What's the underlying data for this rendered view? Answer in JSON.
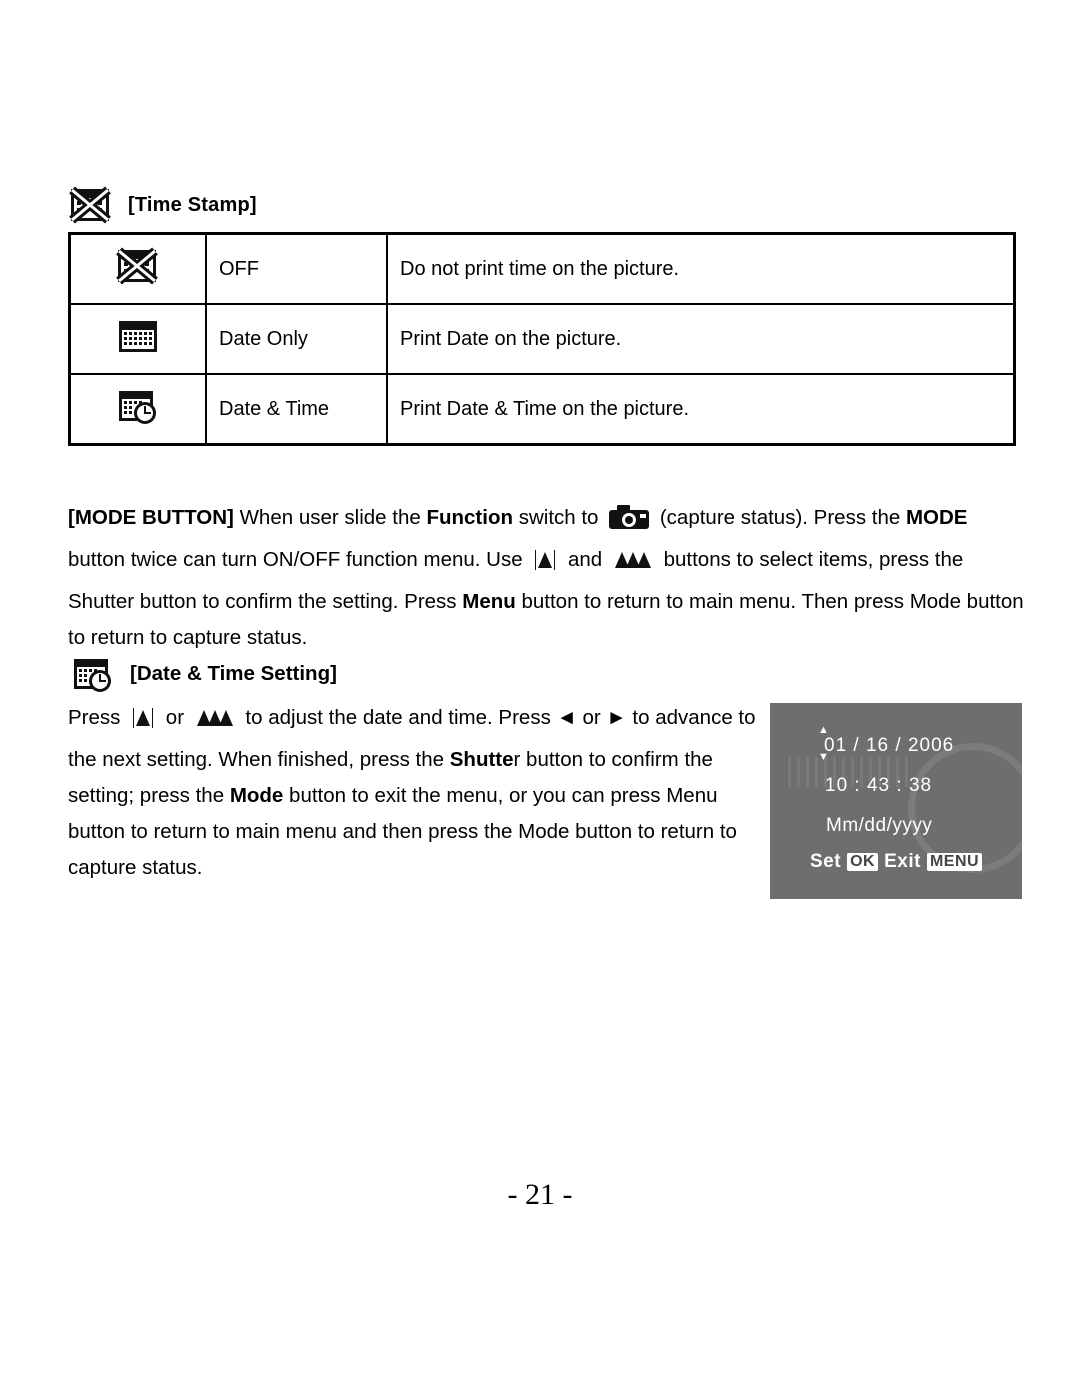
{
  "timestamp_section": {
    "heading": "[Time Stamp]",
    "rows": [
      {
        "icon": "no-timestamp-icon",
        "name": "OFF",
        "description": "Do not print time on the picture."
      },
      {
        "icon": "calendar-icon",
        "name": "Date Only",
        "description": "Print Date on the picture."
      },
      {
        "icon": "calendar-clock-icon",
        "name": "Date & Time",
        "description": "Print Date & Time on the picture."
      }
    ]
  },
  "mode_button_paragraph": {
    "t1": "[MODE BUTTON]",
    "t2": " When user slide the ",
    "t3": "Function",
    "t4": " switch to ",
    "t5": " (capture status). Press the ",
    "t6": "MODE",
    "t7": " button twice can turn ON/OFF function menu. Use ",
    "t8": " and ",
    "t9": " buttons to select items, press the Shutter button to confirm the setting. Press ",
    "t10": "Menu",
    "t11": " button to return to main menu. Then press Mode button to return to capture status."
  },
  "datetime_section": {
    "heading": "[Date & Time Setting]",
    "p1": "Press ",
    "p2": " or ",
    "p3": " to adjust the date and time. Press ◄ or ► to advance to the next setting. When finished, press the ",
    "p4": "Shutte",
    "p5": "r button to confirm the setting; press the ",
    "p6": "Mode",
    "p7": " button to exit the menu, or you can press Menu button to return to main menu and then press the Mode button to return to capture status."
  },
  "lcd_preview": {
    "date": "01 / 16 / 2006",
    "time": "10 : 43 : 38",
    "format": "Mm/dd/yyyy",
    "set_label": "Set",
    "set_key": "OK",
    "exit_label": "Exit",
    "exit_key": "MENU",
    "arrow_up": "▲",
    "arrow_down": "▼",
    "background": "#6e6e6e"
  },
  "footer": {
    "page": "- 21 -"
  }
}
